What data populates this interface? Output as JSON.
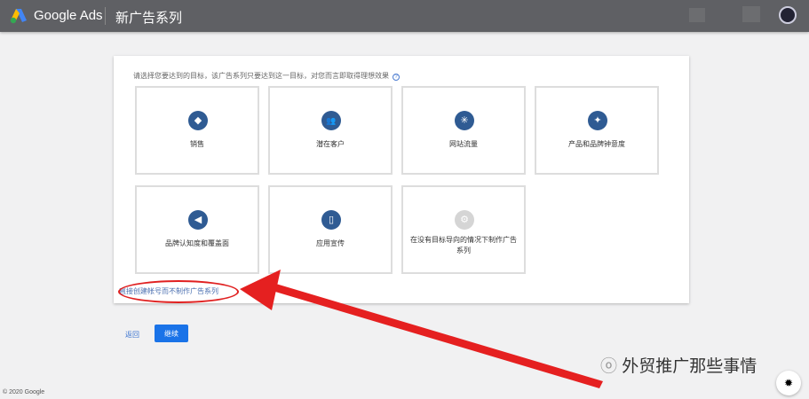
{
  "header": {
    "brand": "Google Ads",
    "title": "新广告系列"
  },
  "panel": {
    "instruction": "请选择您要达到的目标，该广告系列只要达到这一目标，对您而言即取得理想效果",
    "help_icon": "?",
    "goals": [
      {
        "label": "销售",
        "icon": "tag-icon",
        "glyph": "◆"
      },
      {
        "label": "潜在客户",
        "icon": "people-icon",
        "glyph": "👥"
      },
      {
        "label": "网站流量",
        "icon": "cursor-click-icon",
        "glyph": "✳"
      },
      {
        "label": "产品和品牌钟意度",
        "icon": "sparkle-icon",
        "glyph": "✦"
      },
      {
        "label": "品牌认知度和覆盖面",
        "icon": "megaphone-icon",
        "glyph": "◀"
      },
      {
        "label": "应用宣传",
        "icon": "phone-icon",
        "glyph": "▯"
      },
      {
        "label": "在没有目标导向的情况下制作广告系列",
        "icon": "gear-icon",
        "glyph": "⚙"
      }
    ],
    "skip_link": "直接创建帐号而不制作广告系列"
  },
  "actions": {
    "back": "返回",
    "continue": "继续"
  },
  "footer": {
    "copyright": "© 2020 Google"
  },
  "watermark": "外贸推广那些事情",
  "colors": {
    "accent": "#1a73e8",
    "icon_bg": "#2f5b93",
    "annotation": "#e02020"
  }
}
